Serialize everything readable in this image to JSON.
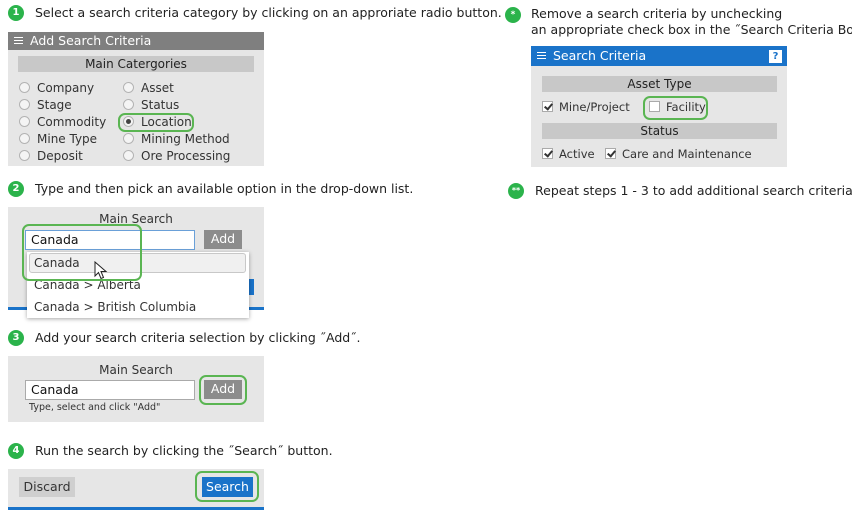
{
  "steps": {
    "s1_badge": "1",
    "s1_text": "Select a search criteria category by clicking on an approriate radio button.",
    "s2_badge": "2",
    "s2_text": "Type and then pick an available option in the drop-down list.",
    "s3_badge": "3",
    "s3_text": "Add your search criteria selection by clicking ˝Add˝.",
    "s4_badge": "4",
    "s4_text": "Run the search by clicking the ˝Search˝ button.",
    "s5_badge": "*",
    "s5_text_line1": "Remove a search criteria by unchecking",
    "s5_text_line2": "an appropriate check box in the ˝Search Criteria Box˝.",
    "s6_badge": "**",
    "s6_text": "Repeat steps 1 - 3 to add additional search criteria."
  },
  "add_criteria": {
    "title": "Add Search Criteria",
    "section_header": "Main Catergories",
    "left_options": [
      {
        "label": "Company",
        "checked": false
      },
      {
        "label": "Stage",
        "checked": false
      },
      {
        "label": "Commodity",
        "checked": false
      },
      {
        "label": "Mine Type",
        "checked": false
      },
      {
        "label": "Deposit",
        "checked": false
      }
    ],
    "right_options": [
      {
        "label": "Asset",
        "checked": false
      },
      {
        "label": "Status",
        "checked": false
      },
      {
        "label": "Location",
        "checked": true
      },
      {
        "label": "Mining Method",
        "checked": false
      },
      {
        "label": "Ore Processing",
        "checked": false
      }
    ]
  },
  "main_search_2": {
    "header": "Main Search",
    "input_value": "Canada",
    "add_label": "Add",
    "dropdown": [
      "Canada",
      "Canada > Alberta",
      "Canada > British Columbia"
    ]
  },
  "main_search_3": {
    "header": "Main Search",
    "input_value": "Canada",
    "add_label": "Add",
    "hint": "Type, select and click \"Add\""
  },
  "run_bar": {
    "discard_label": "Discard",
    "search_label": "Search"
  },
  "search_criteria": {
    "title": "Search Criteria",
    "help": "?",
    "asset_type_header": "Asset Type",
    "asset_items": [
      {
        "label": "Mine/Project",
        "checked": true
      },
      {
        "label": "Facility",
        "checked": false
      }
    ],
    "status_header": "Status",
    "status_items": [
      {
        "label": "Active",
        "checked": true
      },
      {
        "label": "Care and Maintenance",
        "checked": true
      }
    ]
  },
  "colors": {
    "accent_green": "#2bb34b",
    "highlight_green": "#5ab552",
    "primary_blue": "#1a73c9",
    "panel_grey": "#e6e6e6"
  }
}
